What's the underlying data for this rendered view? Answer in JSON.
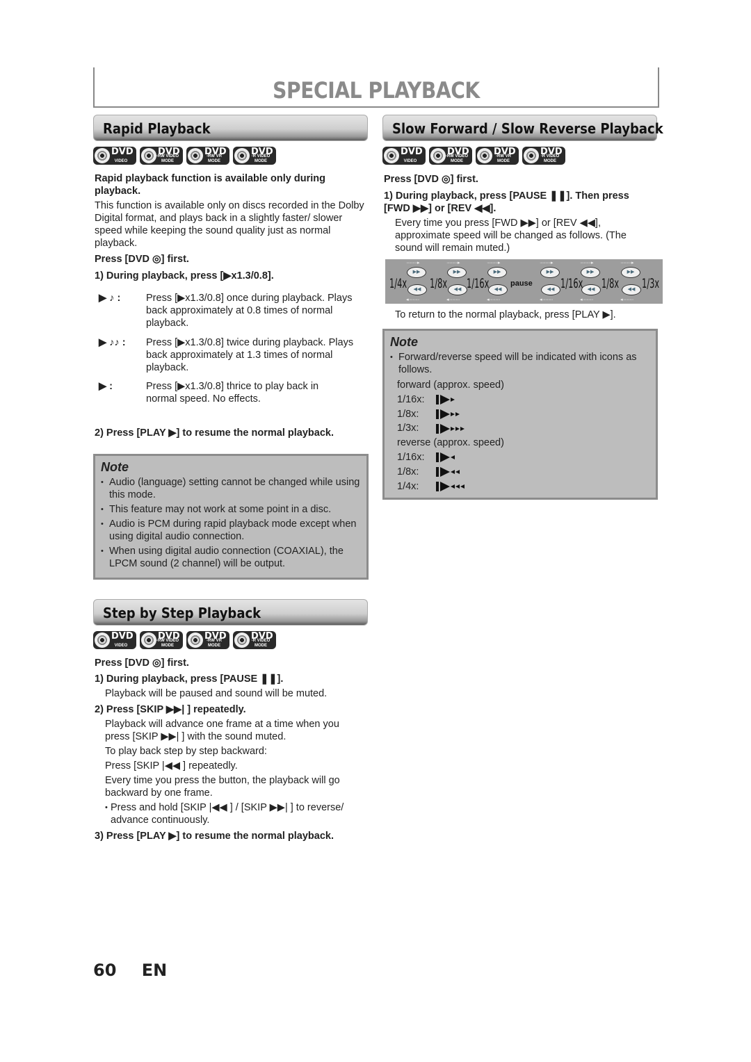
{
  "page_title": "SPECIAL PLAYBACK",
  "badges": [
    {
      "main": "DVD",
      "sub": "VIDEO"
    },
    {
      "main": "DVD",
      "sub": "-RW VIDEO MODE"
    },
    {
      "main": "DVD",
      "sub": "-RW VR MODE"
    },
    {
      "main": "DVD",
      "sub": "-R VIDEO MODE"
    }
  ],
  "rapid": {
    "heading": "Rapid Playback",
    "intro_bold": "Rapid playback function is available only during playback.",
    "intro": "This function is available only on discs recorded in the Dolby Digital format, and plays back in a slightly faster/ slower speed while keeping the sound quality just as normal playback.",
    "press_first": "Press [DVD ◎] first.",
    "step1": "1) During playback, press [▶x1.3/0.8].",
    "modes": [
      {
        "icon": "▶ ♪ :",
        "text": "Press [▶x1.3/0.8] once during playback. Plays back approximately at 0.8 times of normal playback."
      },
      {
        "icon": "▶ ♪♪ :",
        "text": "Press [▶x1.3/0.8] twice during playback. Plays back approximately at 1.3 times of normal playback."
      },
      {
        "icon": "▶ :",
        "text": "Press [▶x1.3/0.8] thrice to play back in normal speed. No effects."
      }
    ],
    "step2": "2) Press [PLAY ▶] to resume the normal playback.",
    "note_title": "Note",
    "notes": [
      "Audio (language) setting cannot be changed while using this mode.",
      "This feature may not work at some point in a disc.",
      "Audio is PCM during rapid playback mode except when using digital audio connection.",
      "When using digital audio connection (COAXIAL), the LPCM sound (2 channel) will be output."
    ]
  },
  "step": {
    "heading": "Step by Step Playback",
    "press_first": "Press [DVD ◎] first.",
    "step1": "1) During playback, press [PAUSE ❚❚].",
    "step1_desc": "Playback will be paused and sound will be muted.",
    "step2": "2) Press [SKIP ▶▶| ] repeatedly.",
    "step2_desc1": "Playback will advance one frame at a time when you press [SKIP ▶▶| ] with the sound muted.",
    "step2_desc2": "To play back step by step backward:",
    "step2_desc3": "Press [SKIP |◀◀ ] repeatedly.",
    "step2_desc4": "Every time you press the button, the playback will go backward by one frame.",
    "step2_bullet": "Press and hold [SKIP |◀◀ ] / [SKIP ▶▶| ] to reverse/ advance continuously.",
    "step3": "3) Press [PLAY ▶] to resume the normal playback."
  },
  "slow": {
    "heading": "Slow Forward / Slow Reverse Playback",
    "press_first": "Press [DVD ◎] first.",
    "step1": "1) During playback, press [PAUSE ❚❚]. Then press [FWD ▶▶] or [REV ◀◀].",
    "step1_desc": "Every time you press [FWD ▶▶] or [REV ◀◀], approximate speed will be changed as follows. (The sound will remain muted.)",
    "speeds": [
      "1/4x",
      "1/8x",
      "1/16x",
      "pause",
      "1/16x",
      "1/8x",
      "1/3x"
    ],
    "btn_fwd": "▶▶",
    "btn_rev": "◀◀",
    "return_text": "To return to the normal playback, press [PLAY ▶].",
    "note_title": "Note",
    "note_bullet": "Forward/reverse speed will be indicated with icons as follows.",
    "forward_label": "forward (approx. speed)",
    "forward": [
      {
        "label": "1/16x:",
        "count": 1
      },
      {
        "label": "1/8x:",
        "count": 2
      },
      {
        "label": "1/3x:",
        "count": 3
      }
    ],
    "reverse_label": "reverse (approx. speed)",
    "reverse": [
      {
        "label": "1/16x:",
        "count": 1
      },
      {
        "label": "1/8x:",
        "count": 2
      },
      {
        "label": "1/4x:",
        "count": 3
      }
    ]
  },
  "footer": {
    "page": "60",
    "lang": "EN"
  }
}
